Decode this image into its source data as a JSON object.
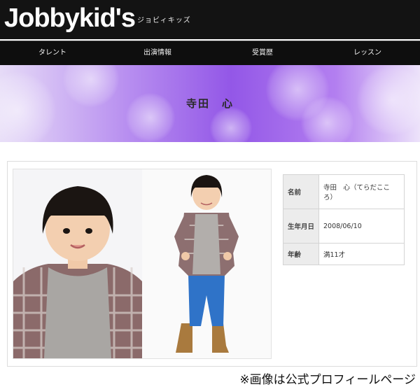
{
  "header": {
    "logo": "Jobbykid's",
    "logo_sub": "ジョビィキッズ"
  },
  "nav": {
    "items": [
      "タレント",
      "出演情報",
      "受賞歴",
      "レッスン"
    ]
  },
  "banner": {
    "title": "寺田　心"
  },
  "profile": {
    "rows": [
      {
        "label": "名前",
        "value": "寺田　心（てらだこころ）"
      },
      {
        "label": "生年月日",
        "value": "2008/06/10"
      },
      {
        "label": "年齢",
        "value": "満11才"
      }
    ]
  },
  "caption": "※画像は公式プロフィールページ",
  "colors": {
    "header_bg": "#131313",
    "banner_accent": "#9357e7"
  }
}
